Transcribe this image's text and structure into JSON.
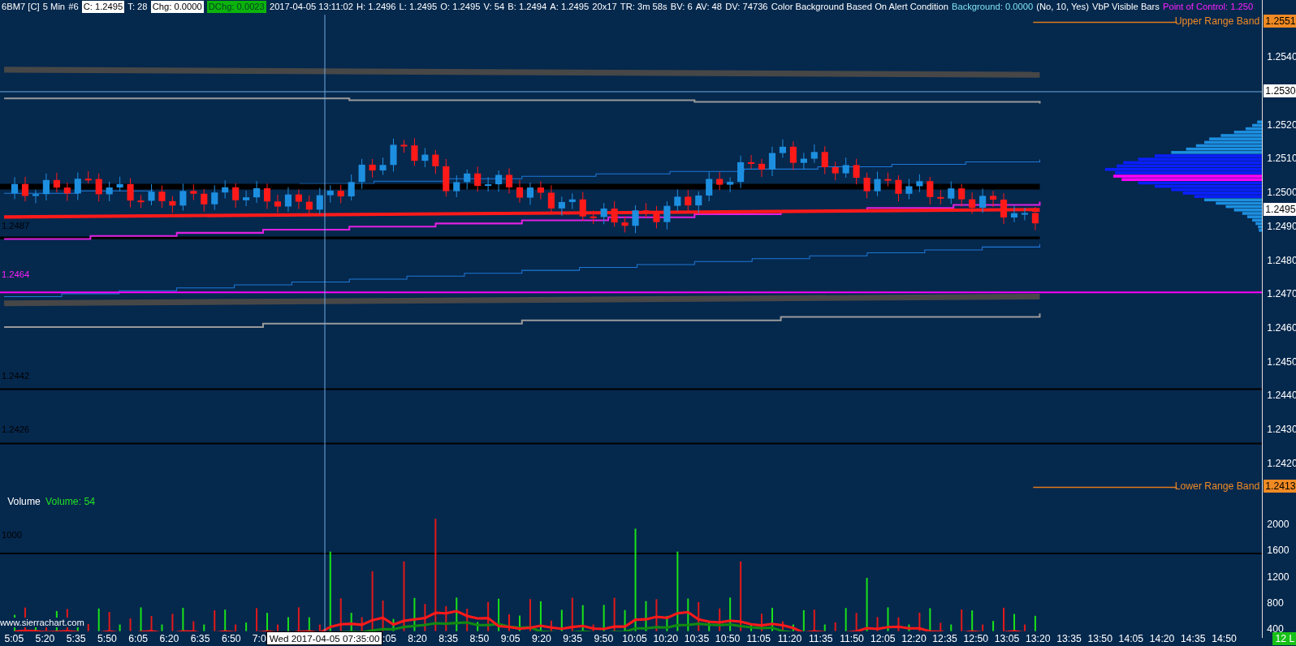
{
  "header": [
    {
      "text": "6BM7 [C]",
      "kind": "plain"
    },
    {
      "text": "5 Min",
      "kind": "plain"
    },
    {
      "text": "#6",
      "kind": "plain"
    },
    {
      "text": "C: 1.2495",
      "kind": "boxed"
    },
    {
      "text": "T: 28",
      "kind": "plain"
    },
    {
      "text": "Chg: 0.0000",
      "kind": "boxed"
    },
    {
      "text": "DChg: 0.0023",
      "kind": "green"
    },
    {
      "text": "2017-04-05 13:11:02",
      "kind": "plain"
    },
    {
      "text": "H: 1.2496",
      "kind": "plain"
    },
    {
      "text": "L: 1.2495",
      "kind": "plain"
    },
    {
      "text": "O: 1.2495",
      "kind": "plain"
    },
    {
      "text": "V: 54",
      "kind": "plain"
    },
    {
      "text": "B: 1.2494",
      "kind": "plain"
    },
    {
      "text": "A: 1.2495",
      "kind": "plain"
    },
    {
      "text": "20x17",
      "kind": "plain"
    },
    {
      "text": "TR: 3m 58s",
      "kind": "plain"
    },
    {
      "text": "BV: 6",
      "kind": "plain"
    },
    {
      "text": "AV: 48",
      "kind": "plain"
    },
    {
      "text": "DV: 74736",
      "kind": "plain"
    },
    {
      "text": "Color Background Based On Alert Condition",
      "kind": "plain"
    },
    {
      "text": "Background: 0.0000",
      "kind": "cyan"
    },
    {
      "text": "(No, 10, Yes)",
      "kind": "plain"
    },
    {
      "text": "VbP Visible Bars",
      "kind": "plain"
    },
    {
      "text": "Point of Control: 1.250",
      "kind": "magenta"
    }
  ],
  "range_bands": [
    {
      "label": "Upper Range Band"
    },
    {
      "label": "Lower Range Band"
    }
  ],
  "chart_labels": [
    {
      "text": "1.2487",
      "kind": "black"
    },
    {
      "text": "1.2464",
      "kind": "magenta"
    },
    {
      "text": "1.2442",
      "kind": "black"
    },
    {
      "text": "1.2426",
      "kind": "black"
    },
    {
      "text": "1000",
      "kind": "black"
    }
  ],
  "watermark_link": "www.sierrachart.com",
  "volume_pane": {
    "title": "Volume",
    "reading": "Volume: 54"
  },
  "price_axis": {
    "upper_ticks": [
      "1.2540"
    ],
    "lower_ticks": [
      "1.2520",
      "1.2510",
      "1.2500",
      "1.2490",
      "1.2480",
      "1.2470",
      "1.2460",
      "1.2450",
      "1.2440",
      "1.2430",
      "1.2420"
    ],
    "markers": [
      {
        "text": "1.2551",
        "kind": "band"
      },
      {
        "text": "1.2530",
        "kind": "cursor"
      },
      {
        "text": "1.2495",
        "kind": "last"
      },
      {
        "text": "1.2413",
        "kind": "band"
      }
    ]
  },
  "volume_axis": [
    "2000",
    "1600",
    "1200",
    "800",
    "400"
  ],
  "time_axis": {
    "ticks_before": [
      "5:05",
      "5:20",
      "5:35",
      "5:50",
      "6:05",
      "6:20",
      "6:35",
      "6:50",
      "7:0"
    ],
    "cursor": "Wed 2017-04-05  07:35:00",
    "ticks_after": [
      ":05",
      "8:20",
      "8:35",
      "8:50",
      "9:05",
      "9:20",
      "9:35",
      "9:50",
      "10:05",
      "10:20",
      "10:35",
      "10:50",
      "11:05",
      "11:20",
      "11:35",
      "11:50",
      "12:05",
      "12:20",
      "12:35",
      "12:50",
      "13:05",
      "13:20",
      "13:35",
      "13:50",
      "14:05",
      "14:20",
      "14:35",
      "14:50"
    ]
  },
  "status_badge": "12 L"
}
